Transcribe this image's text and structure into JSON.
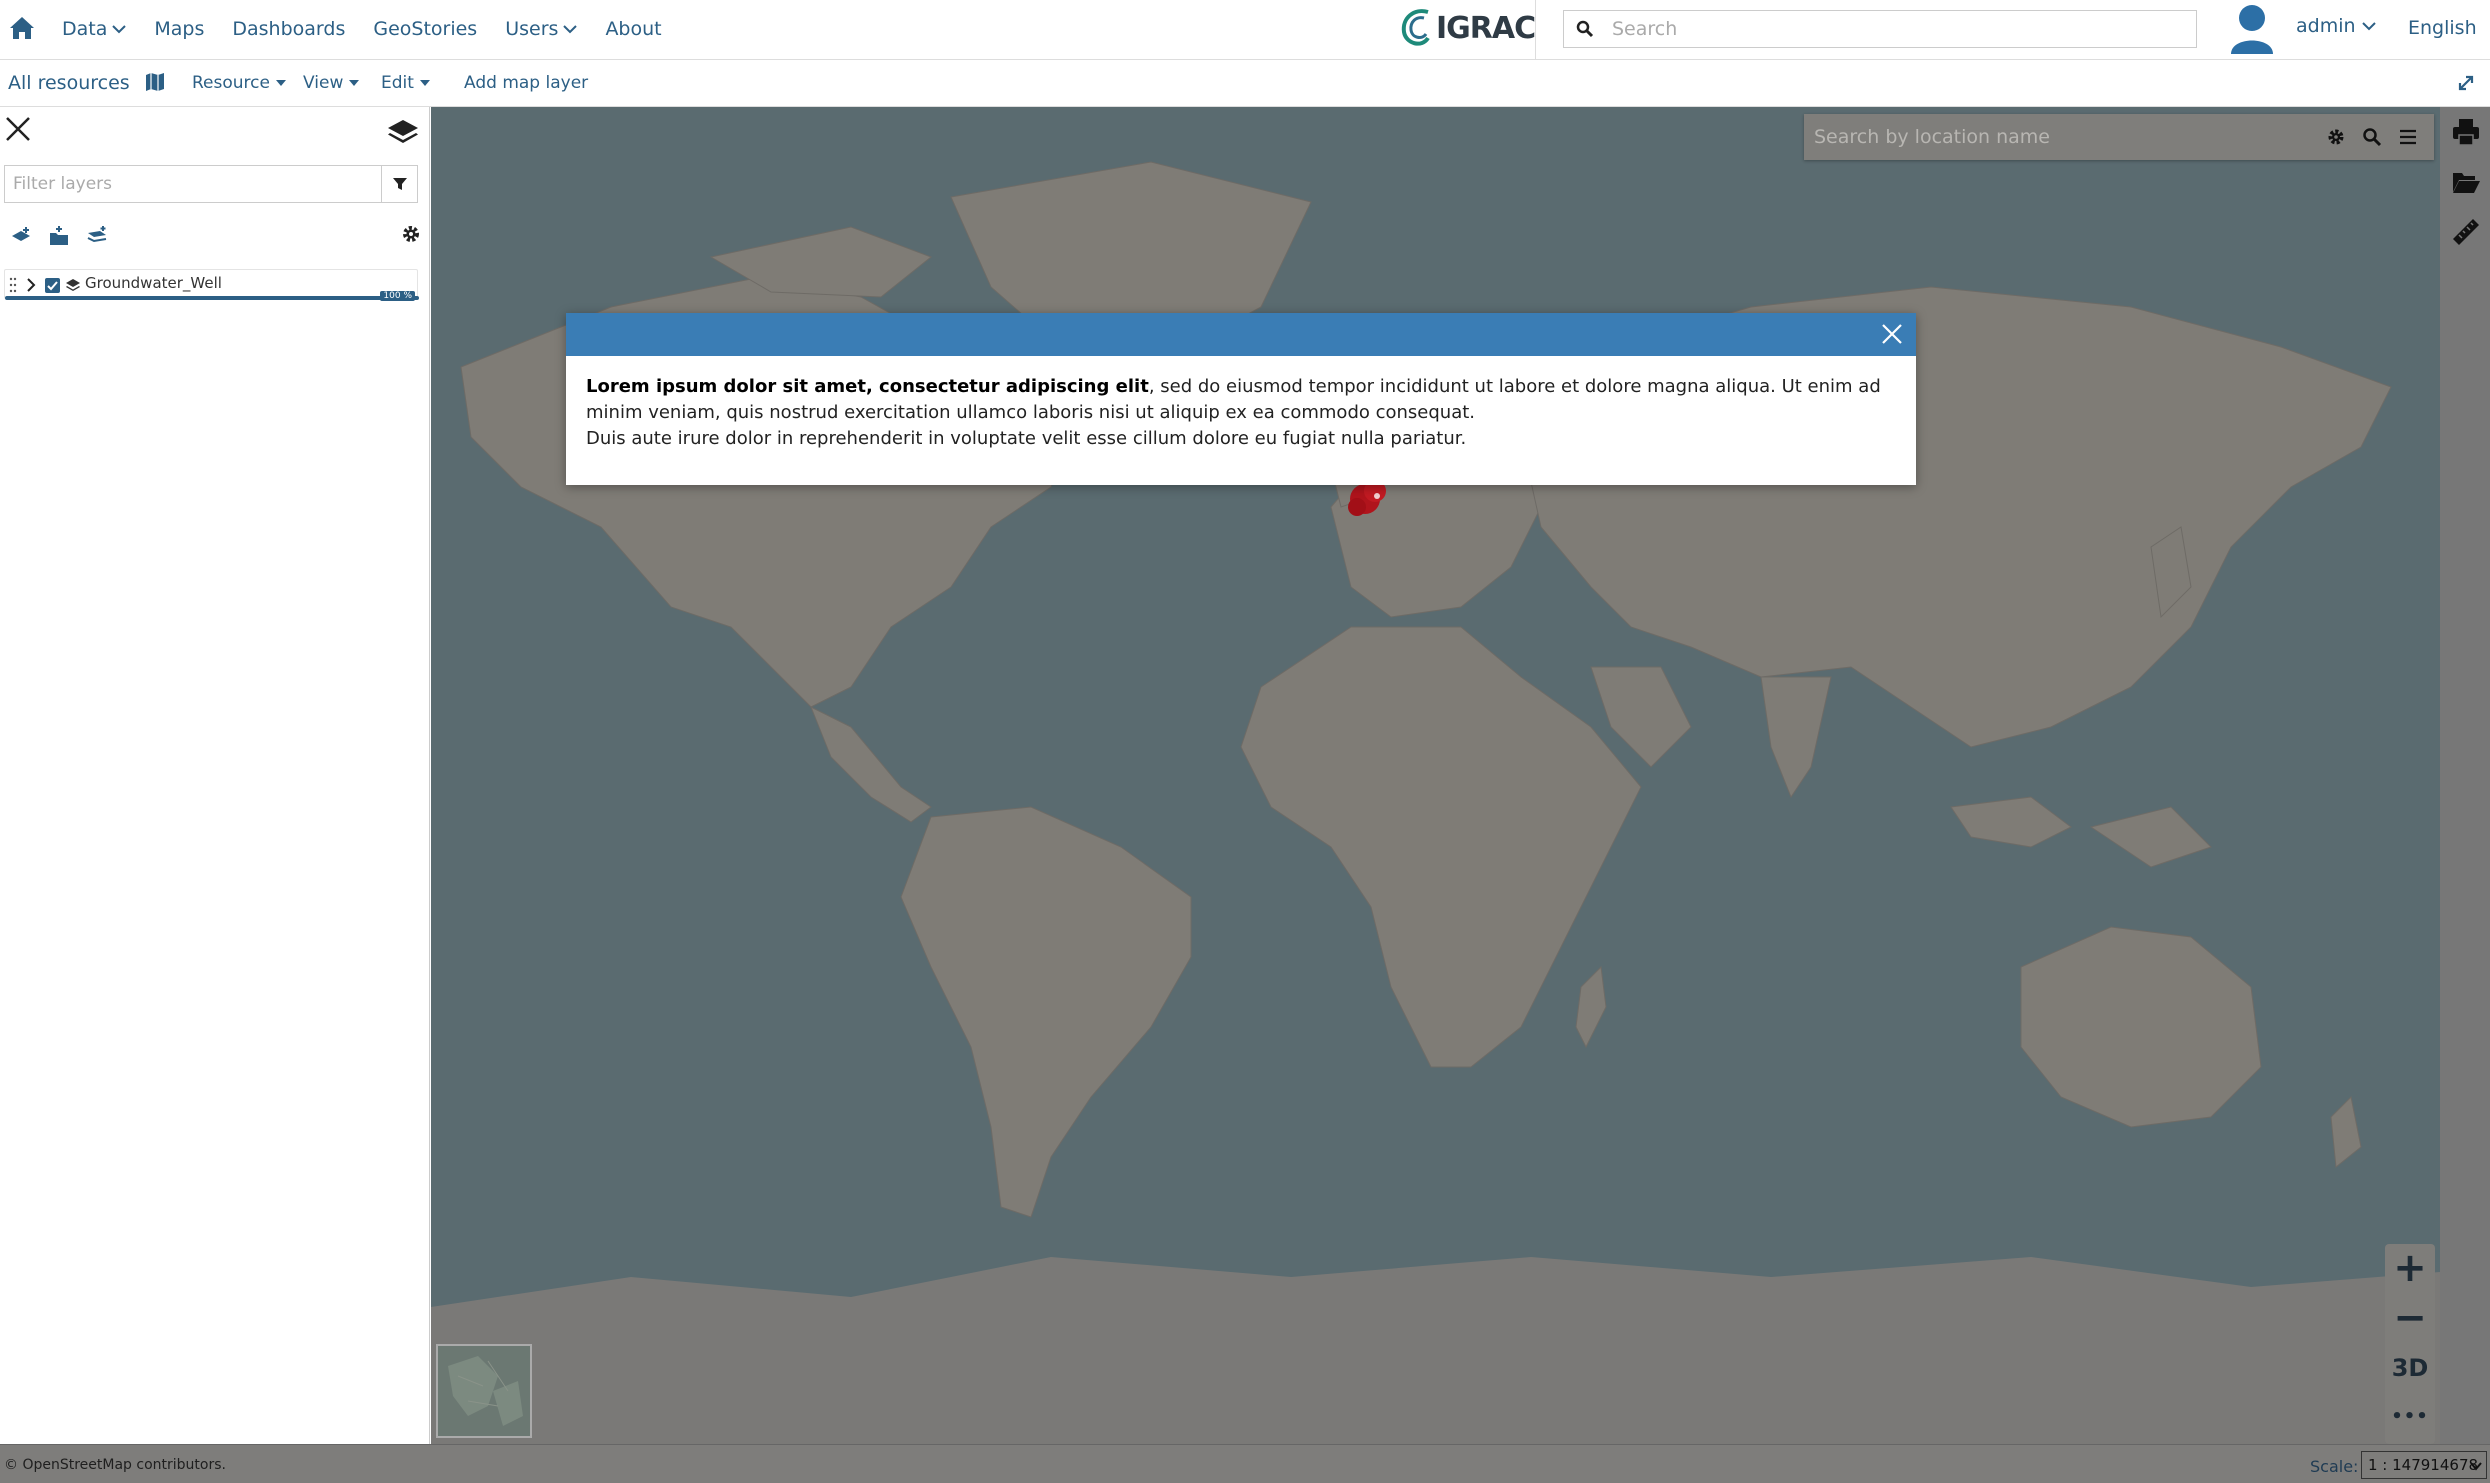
{
  "topnav": {
    "items": [
      {
        "label": "Data",
        "dropdown": true
      },
      {
        "label": "Maps",
        "dropdown": false
      },
      {
        "label": "Dashboards",
        "dropdown": false
      },
      {
        "label": "GeoStories",
        "dropdown": false
      },
      {
        "label": "Users",
        "dropdown": true
      },
      {
        "label": "About",
        "dropdown": false
      }
    ],
    "logo_text": "IGRAC",
    "search_placeholder": "Search",
    "user_label": "admin",
    "language": "English"
  },
  "toolbar": {
    "all_resources": "All resources",
    "resource": "Resource",
    "view": "View",
    "edit": "Edit",
    "add_map_layer": "Add map layer"
  },
  "layers_panel": {
    "filter_placeholder": "Filter layers",
    "layers": [
      {
        "name": "Groundwater_Well",
        "visible": true,
        "load_percent": "100 %"
      }
    ]
  },
  "map": {
    "search_placeholder": "Search by location name",
    "zoom_in": "+",
    "zoom_out": "−",
    "mode_3d": "3D",
    "more": "•••",
    "marker_color": "#b0141c"
  },
  "footer": {
    "attribution": "© OpenStreetMap contributors.",
    "scale_label": "Scale:",
    "scale_value": "1 : 147914678"
  },
  "modal": {
    "header_color": "#3a7db5",
    "bold_text": "Lorem ipsum dolor sit amet, consectetur adipiscing elit",
    "text_1": ", sed do eiusmod tempor incididunt ut labore et dolore magna aliqua. Ut enim ad minim veniam, quis nostrud exercitation ullamco laboris nisi ut aliquip ex ea commodo consequat.",
    "text_2": "Duis aute irure dolor in reprehenderit in voluptate velit esse cillum dolore eu fugiat nulla pariatur."
  },
  "colors": {
    "link": "#2c5f85",
    "ocean": "#5a6b70",
    "land": "#7f7c76"
  }
}
